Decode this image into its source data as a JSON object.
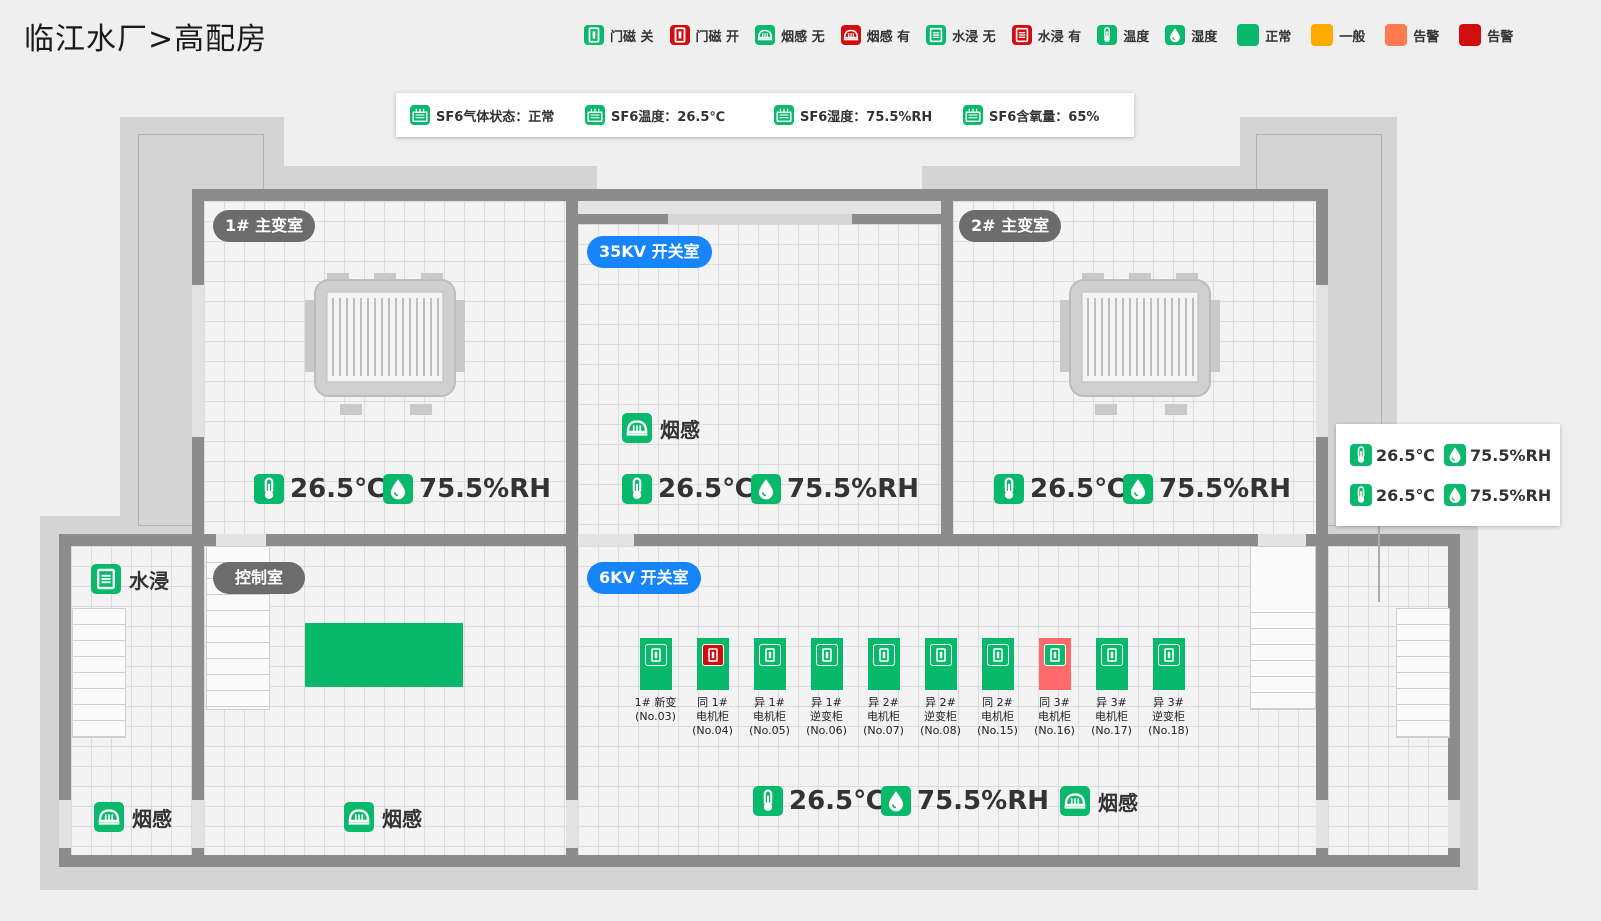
{
  "page": {
    "title": "临江水厂>高配房"
  },
  "legend": [
    {
      "label": "门磁 关",
      "icon": "door-icon",
      "color": "#08b96b"
    },
    {
      "label": "门磁 开",
      "icon": "door-open-icon",
      "color": "#d10d0d"
    },
    {
      "label": "烟感 无",
      "icon": "smoke-icon",
      "color": "#08b96b"
    },
    {
      "label": "烟感 有",
      "icon": "smoke-icon",
      "color": "#d10d0d"
    },
    {
      "label": "水浸 无",
      "icon": "water-leak-icon",
      "color": "#08b96b"
    },
    {
      "label": "水浸 有",
      "icon": "water-leak-icon",
      "color": "#d10d0d"
    },
    {
      "label": "温度",
      "icon": "thermometer-icon",
      "color": "#08b96b"
    },
    {
      "label": "湿度",
      "icon": "humidity-icon",
      "color": "#08b96b"
    },
    {
      "label": "正常",
      "icon": "status-swatch",
      "color": "#08b96b"
    },
    {
      "label": "一般",
      "icon": "status-swatch",
      "color": "#ffaa00"
    },
    {
      "label": "告警",
      "icon": "status-swatch",
      "color": "#ff7a4f"
    },
    {
      "label": "告警",
      "icon": "status-swatch",
      "color": "#d10d0d"
    }
  ],
  "sf6": [
    {
      "label": "SF6气体状态：正常"
    },
    {
      "label": "SF6温度：26.5℃"
    },
    {
      "label": "SF6湿度：75.5%RH"
    },
    {
      "label": "SF6含氧量：65%"
    }
  ],
  "rooms": {
    "t1": {
      "name": "1# 主变室",
      "temp": "26.5℃",
      "hum": "75.5%RH"
    },
    "kv35": {
      "name": "35KV 开关室",
      "smoke": "烟感",
      "temp": "26.5℃",
      "hum": "75.5%RH"
    },
    "t2": {
      "name": "2# 主变室",
      "temp": "26.5℃",
      "hum": "75.5%RH"
    },
    "control": {
      "name": "控制室",
      "smoke": "烟感"
    },
    "left": {
      "water": "水浸",
      "smoke": "烟感"
    },
    "kv6": {
      "name": "6KV 开关室",
      "temp": "26.5℃",
      "hum": "75.5%RH",
      "smoke": "烟感"
    }
  },
  "side_panel": [
    {
      "temp": "26.5℃",
      "hum": "75.5%RH"
    },
    {
      "temp": "26.5℃",
      "hum": "75.5%RH"
    }
  ],
  "cabinets": [
    {
      "line1": "1# 新变",
      "line2": "(No.03)",
      "line3": "",
      "color": "#08b96b",
      "door": "closed"
    },
    {
      "line1": "同 1#",
      "line2": "电机柜",
      "line3": "(No.04)",
      "color": "#08b96b",
      "door": "open"
    },
    {
      "line1": "异 1#",
      "line2": "电机柜",
      "line3": "(No.05)",
      "color": "#08b96b",
      "door": "closed"
    },
    {
      "line1": "异 1#",
      "line2": "逆变柜",
      "line3": "(No.06)",
      "color": "#08b96b",
      "door": "closed"
    },
    {
      "line1": "异 2#",
      "line2": "电机柜",
      "line3": "(No.07)",
      "color": "#08b96b",
      "door": "closed"
    },
    {
      "line1": "异 2#",
      "line2": "逆变柜",
      "line3": "(No.08)",
      "color": "#08b96b",
      "door": "closed"
    },
    {
      "line1": "同 2#",
      "line2": "电机柜",
      "line3": "(No.15)",
      "color": "#08b96b",
      "door": "closed"
    },
    {
      "line1": "同 3#",
      "line2": "电机柜",
      "line3": "(No.16)",
      "color": "#ff6b6b",
      "door": "closed"
    },
    {
      "line1": "异 3#",
      "line2": "电机柜",
      "line3": "(No.17)",
      "color": "#08b96b",
      "door": "closed"
    },
    {
      "line1": "异 3#",
      "line2": "逆变柜",
      "line3": "(No.18)",
      "color": "#08b96b",
      "door": "closed"
    }
  ]
}
